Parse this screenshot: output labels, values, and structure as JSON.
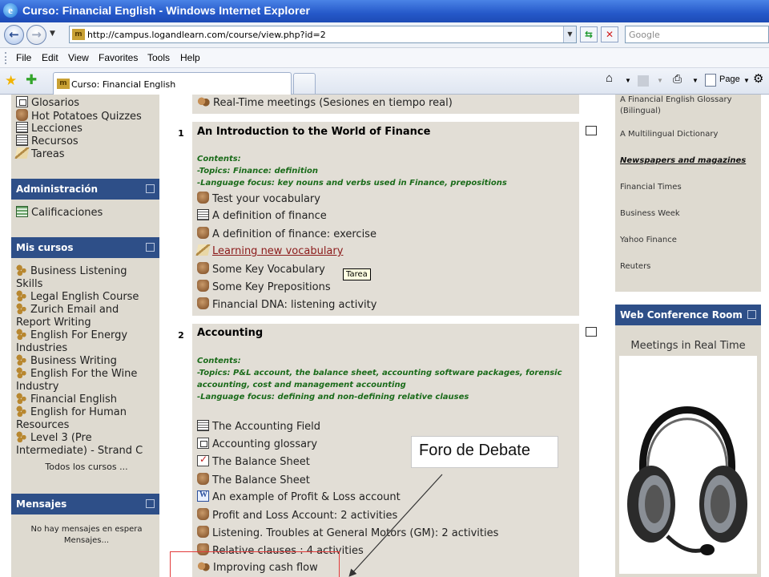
{
  "browser": {
    "window_title": "Curso: Financial English - Windows Internet Explorer",
    "url": "http://campus.logandlearn.com/course/view.php?id=2",
    "search_placeholder": "Google",
    "menu": [
      "File",
      "Edit",
      "View",
      "Favorites",
      "Tools",
      "Help"
    ],
    "tab_title": "Curso: Financial English",
    "page_command": "Page"
  },
  "left_column": {
    "activity_types": [
      {
        "icon": "book",
        "label": "Glosarios"
      },
      {
        "icon": "hand",
        "label": "Hot Potatoes Quizzes"
      },
      {
        "icon": "doc",
        "label": "Lecciones"
      },
      {
        "icon": "doc",
        "label": "Recursos"
      },
      {
        "icon": "tarea",
        "label": "Tareas"
      }
    ],
    "admin_block": {
      "title": "Administración",
      "items": [
        "Calificaciones"
      ]
    },
    "courses_block": {
      "title": "Mis cursos",
      "items": [
        [
          "Business Listening",
          "Skills"
        ],
        [
          "Legal English Course"
        ],
        [
          "Zurich Email and",
          "Report Writing"
        ],
        [
          "English For Energy",
          "Industries"
        ],
        [
          "Business Writing"
        ],
        [
          "English For the Wine",
          "Industry"
        ],
        [
          "Financial English"
        ],
        [
          "English for Human",
          "Resources"
        ],
        [
          "Level 3 (Pre",
          "Intermediate) - Strand C"
        ]
      ],
      "all_courses": "Todos los cursos ..."
    },
    "messages_block": {
      "title": "Mensajes",
      "empty_text": "No hay mensajes en espera",
      "link": "Mensajes..."
    }
  },
  "center": {
    "top_item": "Real-Time meetings (Sesiones en tiempo real)",
    "sections": [
      {
        "number": "1",
        "title": "An Introduction to the World of Finance",
        "description": [
          "Contents:",
          "-Topics: Finance: definition",
          "-Language focus: key nouns and verbs used in Finance, prepositions"
        ],
        "activities": [
          {
            "icon": "hand",
            "label": "Test your vocabulary"
          },
          {
            "icon": "doc",
            "label": "A definition of finance"
          },
          {
            "icon": "hand",
            "label": "A definition of finance: exercise"
          },
          {
            "icon": "tarea",
            "label": "Learning new vocabulary",
            "link": true
          },
          {
            "icon": "hand",
            "label": "Some Key Vocabulary"
          },
          {
            "icon": "hand",
            "label": "Some Key Prepositions"
          },
          {
            "icon": "hand",
            "label": "Financial DNA: listening activity"
          }
        ]
      },
      {
        "number": "2",
        "title": "Accounting",
        "description": [
          "Contents:",
          "-Topics: P&L account, the balance sheet, accounting software packages, forensic",
          "accounting, cost and management accounting",
          "-Language focus: defining and non-defining relative clauses"
        ],
        "activities": [
          {
            "icon": "doc",
            "label": "The Accounting Field"
          },
          {
            "icon": "book",
            "label": "Accounting glossary"
          },
          {
            "icon": "check",
            "label": "The Balance Sheet"
          },
          {
            "icon": "hand",
            "label": "The Balance Sheet"
          },
          {
            "icon": "word",
            "label": "An example of Profit & Loss account"
          },
          {
            "icon": "hand",
            "label": "Profit and Loss Account: 2 activities"
          },
          {
            "icon": "hand",
            "label": "Listening. Troubles at General Motors (GM): 2 activities"
          },
          {
            "icon": "hand",
            "label": "Relative clauses : 4 activities"
          },
          {
            "icon": "chat",
            "label": "Improving cash flow"
          }
        ]
      }
    ],
    "tooltip": "Tarea"
  },
  "right_column": {
    "links": [
      [
        "A Financial English Glossary",
        "(Bilingual)"
      ],
      [
        "A Multilingual Dictionary"
      ],
      [
        "Newspapers and magazines"
      ],
      [
        "Financial Times"
      ],
      [
        "Business Week"
      ],
      [
        "Yahoo Finance"
      ],
      [
        "Reuters"
      ]
    ],
    "conference_block": {
      "title": "Web Conference Room",
      "label": "Meetings in Real Time"
    }
  },
  "annotation": {
    "callout_text": "Foro de Debate",
    "highlight_color": "#e23b3b"
  }
}
